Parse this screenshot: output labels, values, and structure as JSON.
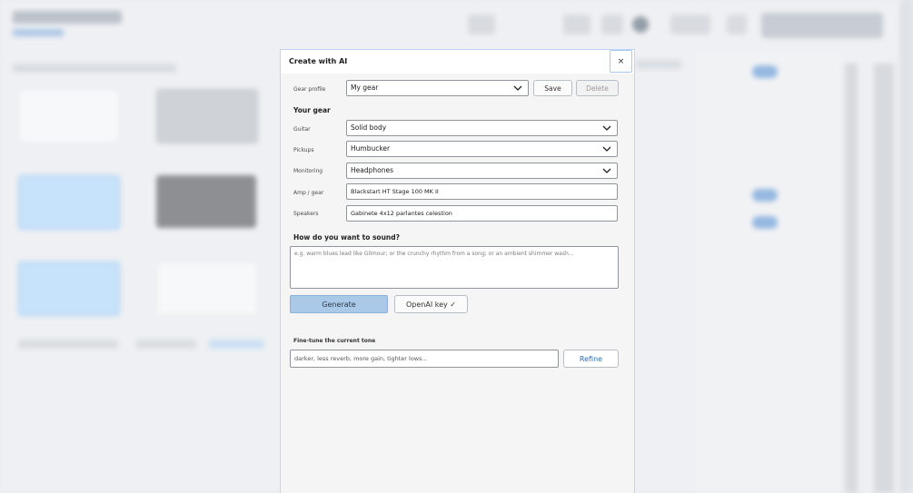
{
  "modal": {
    "title": "Create with AI",
    "close_label": "×",
    "gear_profile_label": "Gear profile",
    "gear_profile_value": "My gear",
    "save_label": "Save",
    "delete_label": "Delete",
    "your_gear_heading": "Your gear",
    "fields": {
      "guitar": {
        "label": "Guitar",
        "value": "Solid body"
      },
      "pickups": {
        "label": "Pickups",
        "value": "Humbucker"
      },
      "monitoring": {
        "label": "Monitoring",
        "value": "Headphones"
      },
      "amp": {
        "label": "Amp / gear",
        "value": "Blackstart HT Stage 100 MK II"
      },
      "speakers": {
        "label": "Speakers",
        "value": "Gabinete 4x12 parlantes celestion"
      }
    },
    "sound_heading": "How do you want to sound?",
    "sound_placeholder": "e.g. warm blues lead like Gilmour; or the crunchy rhythm from a song; or an ambient shimmer wash...",
    "generate_label": "Generate",
    "openai_key_label": "OpenAI key ✓",
    "finetune_label": "Fine-tune the current tone",
    "refine_placeholder": "darker, less reverb, more gain, tighter lows...",
    "refine_label": "Refine"
  },
  "colors": {
    "accent": "#aac8e8",
    "link": "#2a6fb8",
    "border": "#8f959b"
  }
}
